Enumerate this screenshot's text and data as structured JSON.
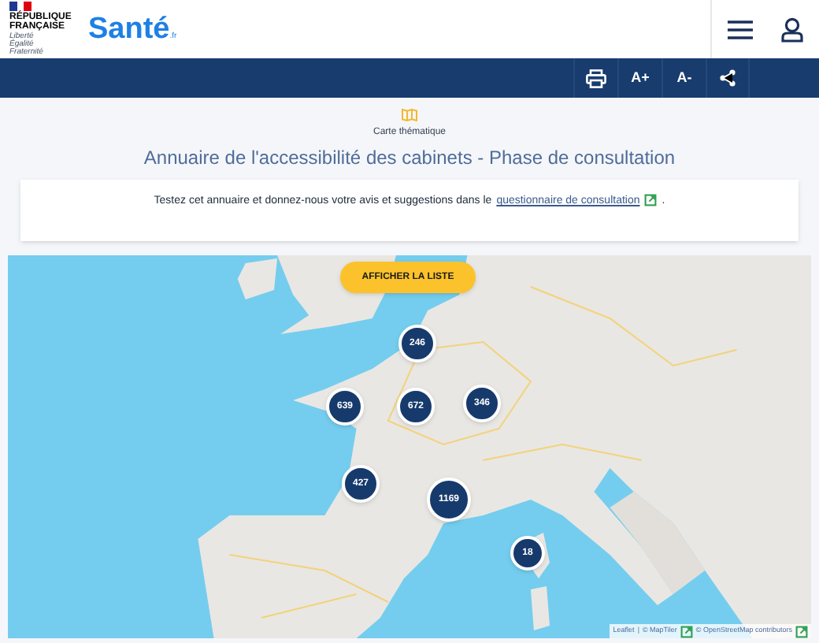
{
  "header": {
    "republic": "RÉPUBLIQUE FRANÇAISE",
    "motto": "Liberté Égalité Fraternité",
    "brand": "Santé",
    "brand_suffix": ".fr"
  },
  "toolbar": [
    {
      "kind": "print"
    },
    {
      "kind": "text",
      "label": "A+"
    },
    {
      "kind": "text",
      "label": "A-"
    },
    {
      "kind": "share"
    }
  ],
  "page": {
    "category": "Carte thématique",
    "title": "Annuaire de l'accessibilité des cabinets - Phase de consultation"
  },
  "notice": {
    "text": "Testez cet annuaire et donnez-nous votre avis et suggestions dans le",
    "link": "questionnaire de consultation",
    "end": "."
  },
  "map": {
    "kind": "picture",
    "list_button": "AFFICHER LA LISTE",
    "clusters": [
      {
        "count": "246"
      },
      {
        "count": "639"
      },
      {
        "count": "672"
      },
      {
        "count": "346"
      },
      {
        "count": "427"
      },
      {
        "count": "1169"
      },
      {
        "count": "18"
      }
    ],
    "attribution": {
      "leaflet": "Leaflet",
      "sep": "|",
      "maptiler": "© MapTiler",
      "osm": "© OpenStreetMap contributors"
    }
  }
}
